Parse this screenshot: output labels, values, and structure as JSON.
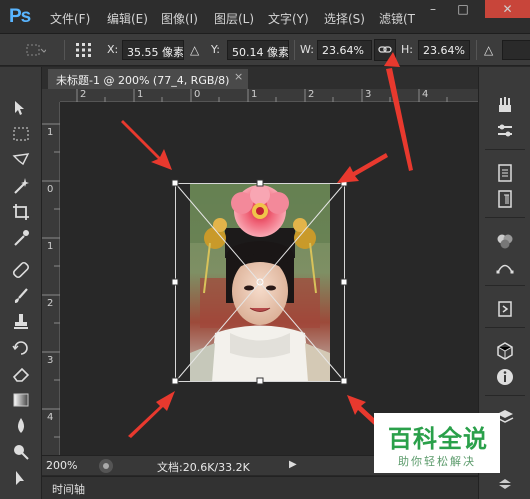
{
  "app": {
    "logo": "Ps",
    "menu": [
      "文件(F)",
      "编辑(E)",
      "图像(I)",
      "图层(L)",
      "文字(Y)",
      "选择(S)",
      "滤镜(T"
    ],
    "window_controls": [
      "–",
      "□",
      "✕"
    ]
  },
  "options_bar": {
    "x_label": "X:",
    "x_value": "35.55 像素",
    "delta_symbol": "△",
    "y_label": "Y:",
    "y_value": "50.14 像素",
    "w_label": "W:",
    "w_value": "23.64%",
    "h_label": "H:",
    "h_value": "23.64%",
    "angle_symbol": "△",
    "link_icon": "link-icon"
  },
  "document": {
    "tab_title": "未标题-1 @ 200% (77_4, RGB/8)",
    "tab_close": "×"
  },
  "rulers": {
    "top_ticks": [
      "2",
      "1",
      "0",
      "1",
      "2",
      "3",
      "4"
    ],
    "left_ticks": [
      "1",
      "0",
      "1",
      "2",
      "3",
      "4"
    ]
  },
  "status": {
    "zoom": "200%",
    "doc_info": "文档:20.6K/33.2K",
    "arrow": "▶"
  },
  "timeline": {
    "label": "时间轴"
  },
  "watermark": {
    "title": "百科全说",
    "subtitle": "助你轻松解决"
  },
  "colors": {
    "arrow_red": "#e8392e",
    "ps_blue": "#59b5ff",
    "watermark_green": "#2aa04a"
  }
}
